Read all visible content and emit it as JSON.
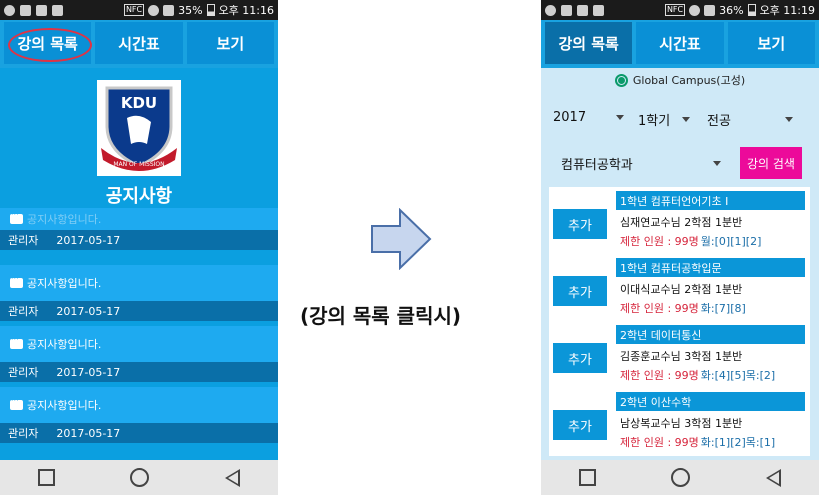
{
  "left_phone": {
    "statusbar": {
      "nfc": "NFC",
      "battery": "35%",
      "time": "오후 11:16"
    },
    "tabs": [
      {
        "label": "강의 목록"
      },
      {
        "label": "시간표"
      },
      {
        "label": "보기"
      }
    ],
    "logo": {
      "text": "KDU",
      "motto": "MAN OF MISSION"
    },
    "notice_title": "공지사항",
    "notices": [
      {
        "text": "공지사항입니다.",
        "author": "관리자",
        "date": "2017-05-17"
      },
      {
        "text": "공지사항입니다.",
        "author": "관리자",
        "date": "2017-05-17"
      },
      {
        "text": "공지사항입니다.",
        "author": "관리자",
        "date": "2017-05-17"
      },
      {
        "text": "공지사항입니다.",
        "author": "관리자",
        "date": "2017-05-17"
      }
    ]
  },
  "caption": "(강의 목록 클릭시)",
  "right_phone": {
    "statusbar": {
      "nfc": "NFC",
      "battery": "36%",
      "time": "오후 11:19"
    },
    "tabs": [
      {
        "label": "강의 목록"
      },
      {
        "label": "시간표"
      },
      {
        "label": "보기"
      }
    ],
    "campus_label": "Global Campus(고성)",
    "filters": {
      "year": "2017",
      "semester": "1학기",
      "category": "전공",
      "department": "컴퓨터공학과"
    },
    "search_button": "강의 검색",
    "courses": [
      {
        "title": "1학년 컴퓨터언어기초 I",
        "professor": "심재연교수님 2학점 1분반",
        "limit": "제한 인원 : 99명",
        "time": "월:[0][1][2]",
        "add_label": "추가"
      },
      {
        "title": "1학년 컴퓨터공학입문",
        "professor": "이대식교수님 2학점 1분반",
        "limit": "제한 인원 : 99명",
        "time": "화:[7][8]",
        "add_label": "추가"
      },
      {
        "title": "2학년 데이터통신",
        "professor": "김종훈교수님 3학점 1분반",
        "limit": "제한 인원 : 99명",
        "time": "화:[4][5]목:[2]",
        "add_label": "추가"
      },
      {
        "title": "2학년 이산수학",
        "professor": "남상복교수님 3학점 1분반",
        "limit": "제한 인원 : 99명",
        "time": "화:[1][2]목:[1]",
        "add_label": "추가"
      }
    ]
  }
}
